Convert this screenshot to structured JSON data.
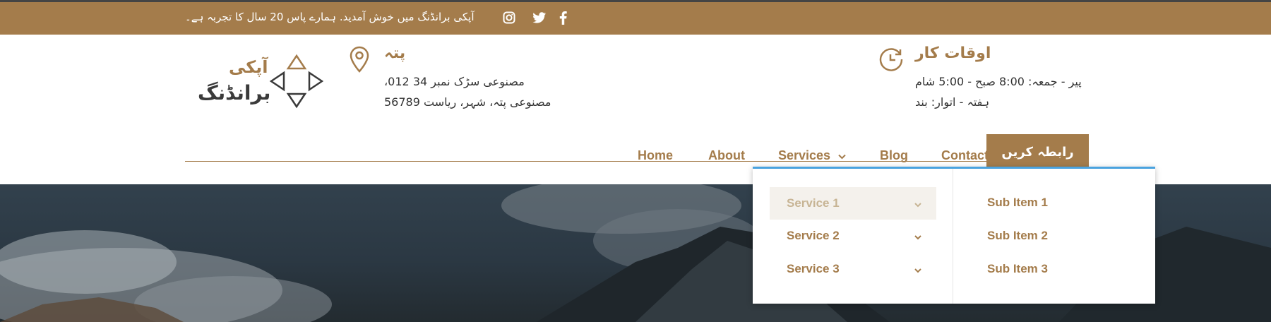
{
  "topbar": {
    "welcome_text": "آپکی برانڈنگ میں خوش آمدید. ہمارے پاس 20 سال کا تجربہ ہے۔",
    "social_icons": [
      "facebook-icon",
      "twitter-icon",
      "instagram-icon"
    ]
  },
  "brand": {
    "line1": "آپکی",
    "line2": "برانڈنگ"
  },
  "address": {
    "title": "پتہ",
    "line1": "مصنوعی سڑک نمبر 34 012،",
    "line2": "مصنوعی پتہ، شہر، ریاست 56789"
  },
  "hours": {
    "title": "اوقات کار",
    "line1": "پیر - جمعہ: 8:00 صبح - 5:00 شام",
    "line2": "ہفتہ - اتوار: بند"
  },
  "nav": {
    "items": [
      {
        "label": "Home"
      },
      {
        "label": "About"
      },
      {
        "label": "Services"
      },
      {
        "label": "Blog"
      },
      {
        "label": "Contact"
      }
    ],
    "cta_label": "رابطہ کریں"
  },
  "dropdown": {
    "services": [
      {
        "label": "Service 1",
        "active": true
      },
      {
        "label": "Service 2",
        "active": false
      },
      {
        "label": "Service 3",
        "active": false
      }
    ],
    "sub_items": [
      {
        "label": "Sub Item 1"
      },
      {
        "label": "Sub Item 2"
      },
      {
        "label": "Sub Item 3"
      }
    ]
  },
  "colors": {
    "accent": "#a47c4b",
    "dropdown_border": "#4aa3df",
    "text": "#333333"
  }
}
